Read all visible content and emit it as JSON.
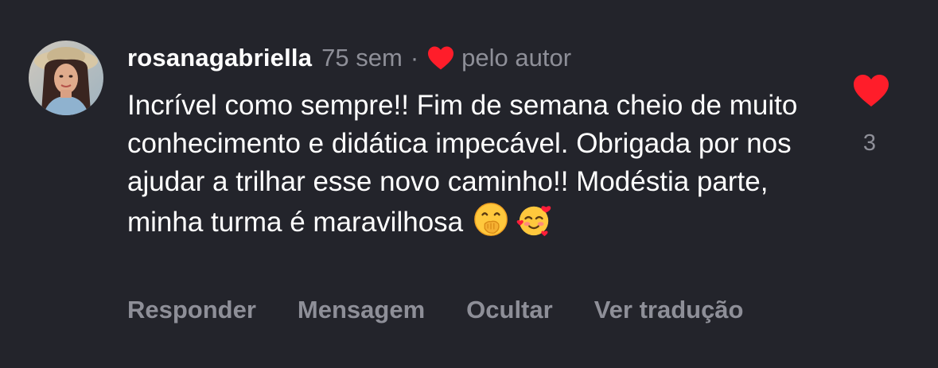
{
  "comment": {
    "username": "rosanagabriella",
    "time": "75 sem",
    "separator": "·",
    "author_like_label": "pelo autor",
    "text": "Incrível como sempre!! Fim de semana cheio de muito conhecimento e didática impecável. Obrigada por nos ajudar a trilhar esse novo caminho!! Modéstia parte, minha turma é maravilhosa",
    "emojis": [
      "face-with-hand-over-mouth",
      "smiling-face-with-hearts"
    ],
    "like_count": "3"
  },
  "actions": {
    "reply": "Responder",
    "message": "Mensagem",
    "hide": "Ocultar",
    "translate": "Ver tradução"
  },
  "colors": {
    "background": "#23242b",
    "text": "#ffffff",
    "muted": "#8e8f98",
    "heart": "#ff1d2a"
  },
  "icons": {
    "author_heart": "heart-icon",
    "like": "heart-filled-icon"
  }
}
